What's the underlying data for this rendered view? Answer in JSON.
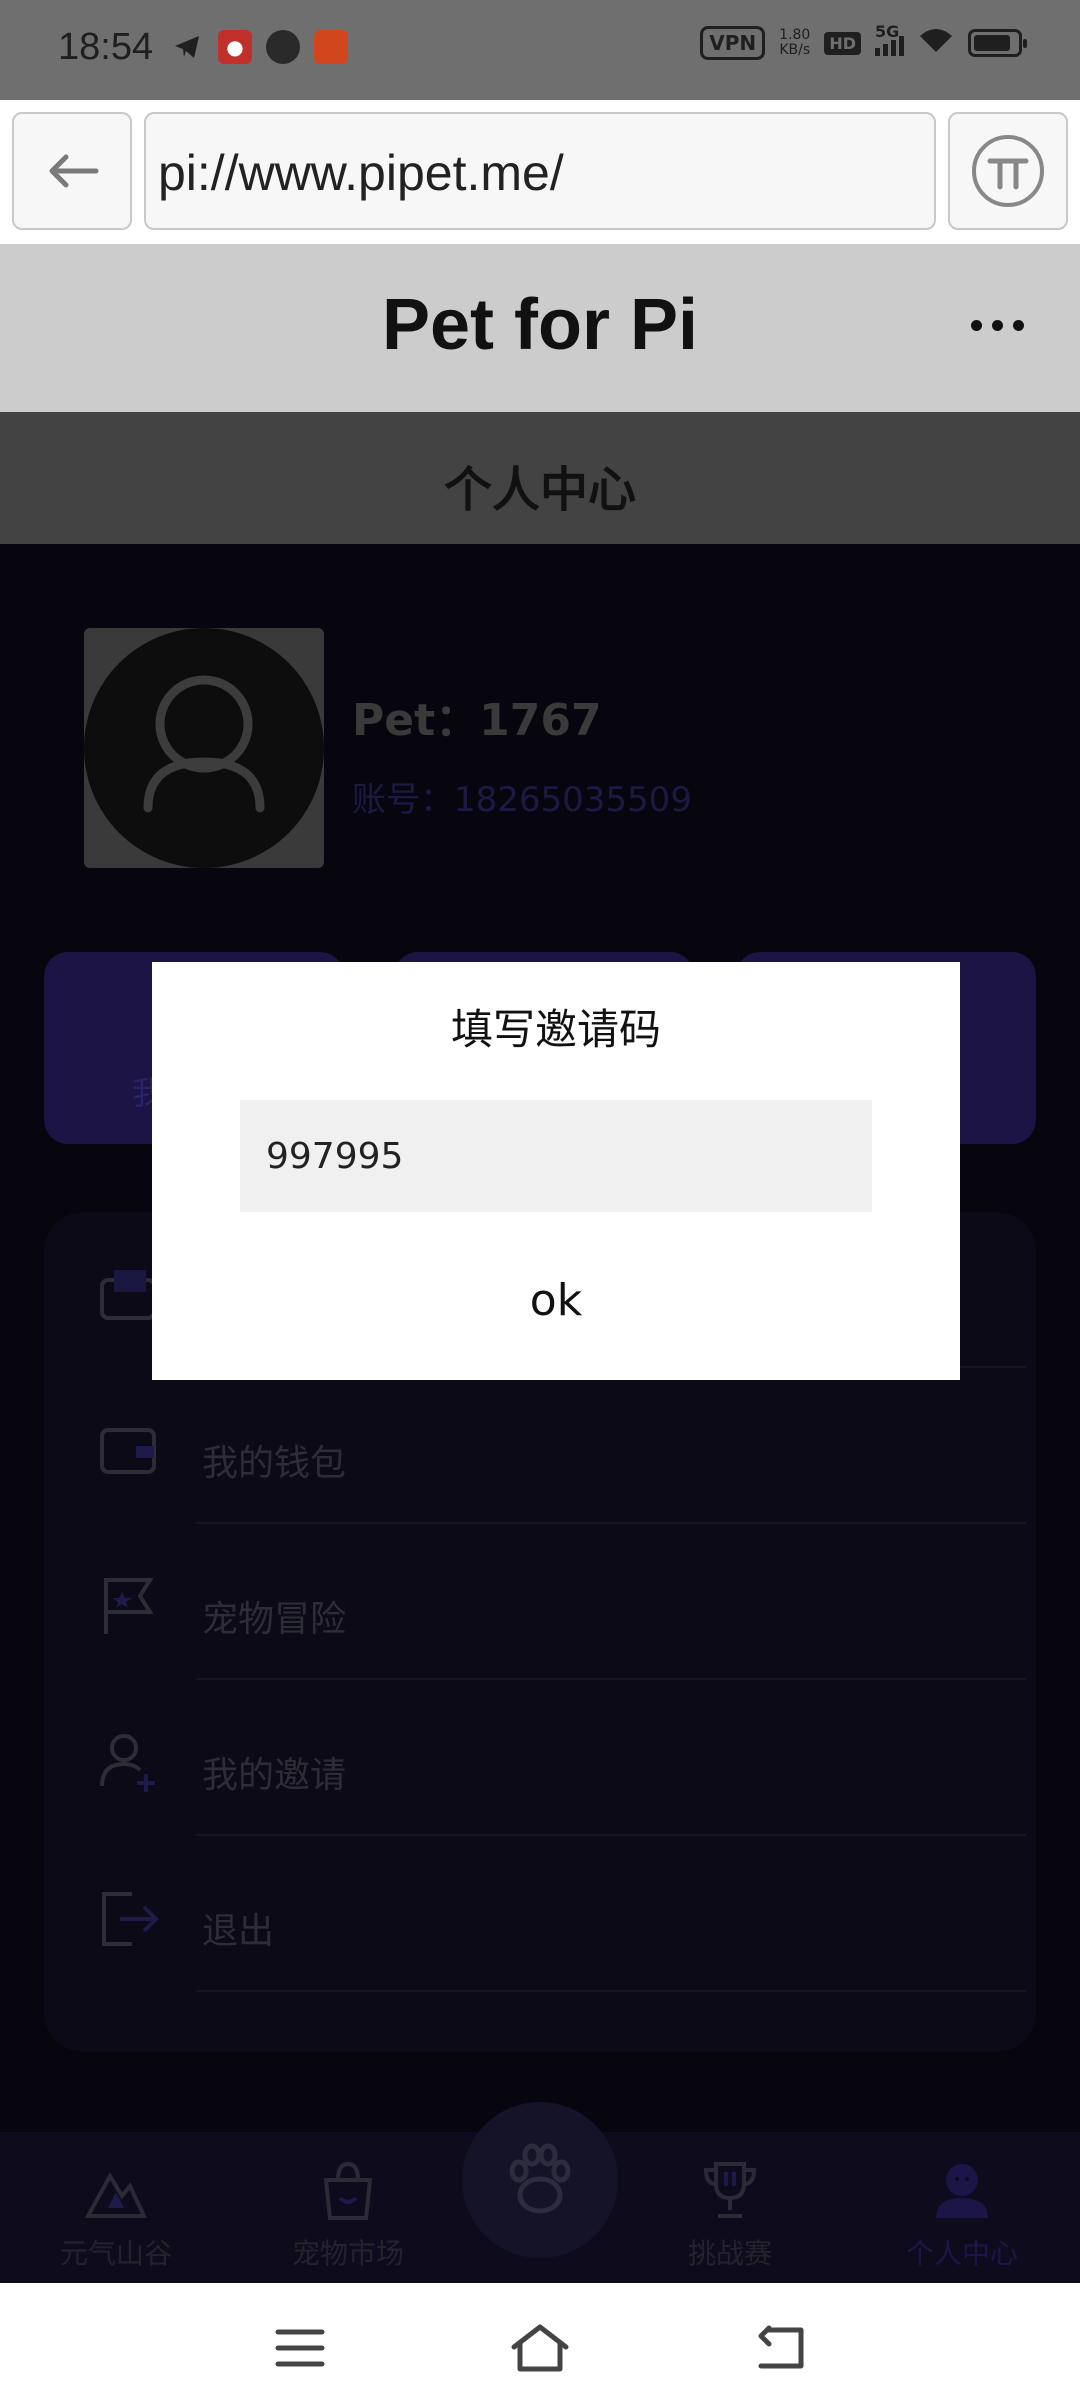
{
  "status_bar": {
    "time": "18:54",
    "vpn": "VPN",
    "speed_value": "1.80",
    "speed_unit": "KB/s",
    "hd": "HD",
    "network": "5G"
  },
  "browser": {
    "url": "pi://www.pipet.me/"
  },
  "app": {
    "title": "Pet for Pi",
    "page_title": "个人中心"
  },
  "profile": {
    "pet_name": "Pet：1767",
    "account": "账号：18265035509"
  },
  "stat_cards": {
    "first_label_partial": "我"
  },
  "menu": {
    "items": [
      {
        "label": "",
        "icon": "mail-icon"
      },
      {
        "label": "我的钱包",
        "icon": "wallet-icon"
      },
      {
        "label": "宠物冒险",
        "icon": "flag-icon"
      },
      {
        "label": "我的邀请",
        "icon": "add-user-icon"
      },
      {
        "label": "退出",
        "icon": "logout-icon"
      }
    ]
  },
  "bottom_nav": {
    "items": [
      {
        "label": "元气山谷",
        "icon": "mountain-icon"
      },
      {
        "label": "宠物市场",
        "icon": "shopping-bag-icon"
      },
      {
        "label": "",
        "icon": "paw-icon"
      },
      {
        "label": "挑战赛",
        "icon": "trophy-icon"
      },
      {
        "label": "个人中心",
        "icon": "profile-icon"
      }
    ]
  },
  "modal": {
    "title": "填写邀请码",
    "input_value": "997995",
    "ok_label": "ok"
  },
  "colors": {
    "accent": "#2a1f6b",
    "background": "#07060f",
    "header": "#cccccc"
  }
}
